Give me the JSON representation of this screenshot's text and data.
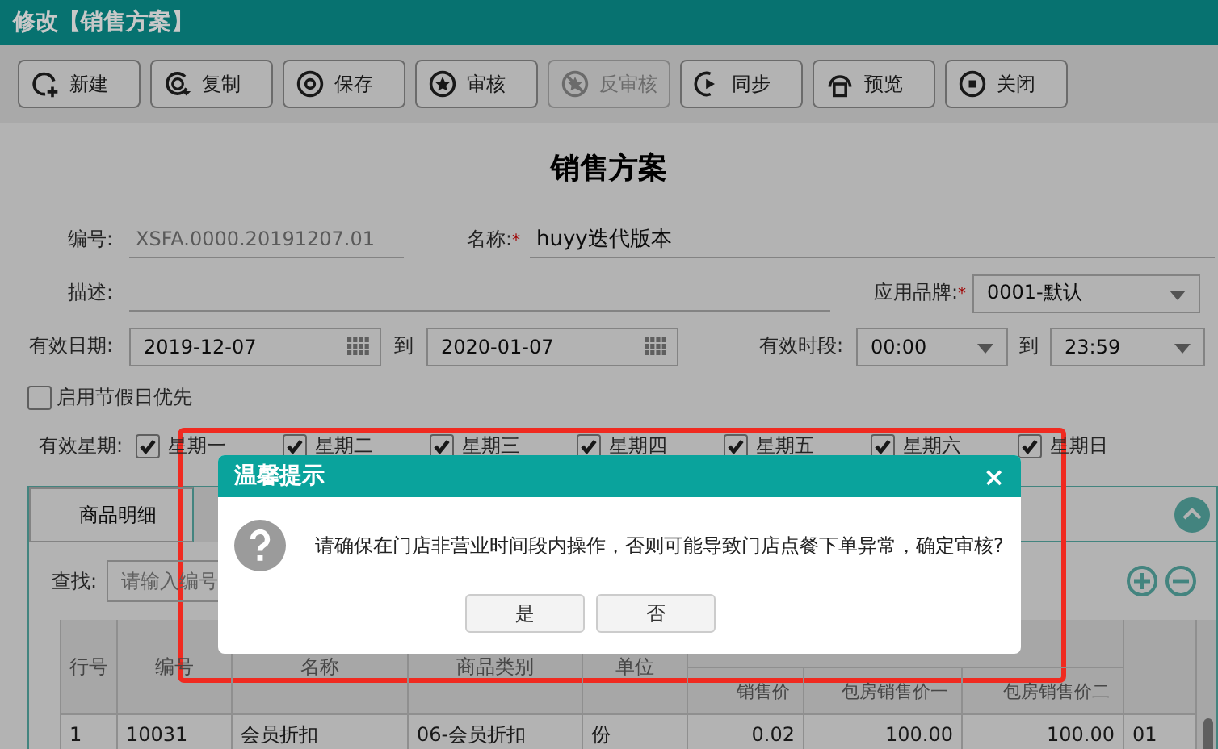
{
  "window": {
    "title": "修改【销售方案】"
  },
  "toolbar": [
    {
      "label": "新建",
      "disabled": false
    },
    {
      "label": "复制",
      "disabled": false
    },
    {
      "label": "保存",
      "disabled": false
    },
    {
      "label": "审核",
      "disabled": false
    },
    {
      "label": "反审核",
      "disabled": true
    },
    {
      "label": "同步",
      "disabled": false
    },
    {
      "label": "预览",
      "disabled": false
    },
    {
      "label": "关闭",
      "disabled": false
    }
  ],
  "form": {
    "title": "销售方案",
    "code": {
      "label": "编号:",
      "value": "XSFA.0000.20191207.01"
    },
    "name": {
      "label": "名称:",
      "required_mark": "*",
      "value": "huyy迭代版本"
    },
    "description": {
      "label": "描述:"
    },
    "brand": {
      "label": "应用品牌:",
      "required_mark": "*",
      "value": "0001-默认"
    },
    "date": {
      "label": "有效日期:",
      "from": "2019-12-07",
      "to_label": "到",
      "to": "2020-01-07"
    },
    "time": {
      "label": "有效时段:",
      "from": "00:00",
      "to_label": "到",
      "to": "23:59"
    },
    "holiday": {
      "label": "启用节假日优先",
      "checked": false
    },
    "weekdays": {
      "label": "有效星期:",
      "days": [
        {
          "label": "星期一",
          "checked": true
        },
        {
          "label": "星期二",
          "checked": true
        },
        {
          "label": "星期三",
          "checked": true
        },
        {
          "label": "星期四",
          "checked": true
        },
        {
          "label": "星期五",
          "checked": true
        },
        {
          "label": "星期六",
          "checked": true
        },
        {
          "label": "星期日",
          "checked": true
        }
      ]
    }
  },
  "tabs": [
    {
      "label": "商品明细",
      "selected": true
    },
    {
      "selected": false
    }
  ],
  "search": {
    "label": "查找:",
    "placeholder": "请输入编号"
  },
  "table": {
    "columns": [
      "行号",
      "编号",
      "名称",
      "商品类别",
      "单位"
    ],
    "sub_columns": [
      "销售价",
      "包房销售价一",
      "包房销售价二"
    ],
    "rows": [
      [
        "1",
        "10031",
        "会员折扣",
        "06-会员折扣",
        "份",
        "0.02",
        "100.00",
        "100.00",
        "01"
      ]
    ]
  },
  "dialog": {
    "title": "温馨提示",
    "close": "×",
    "message": "请确保在门店非营业时间段内操作，否则可能导致门店点餐下单异常，确定审核?",
    "buttons": [
      "是",
      "否"
    ]
  }
}
